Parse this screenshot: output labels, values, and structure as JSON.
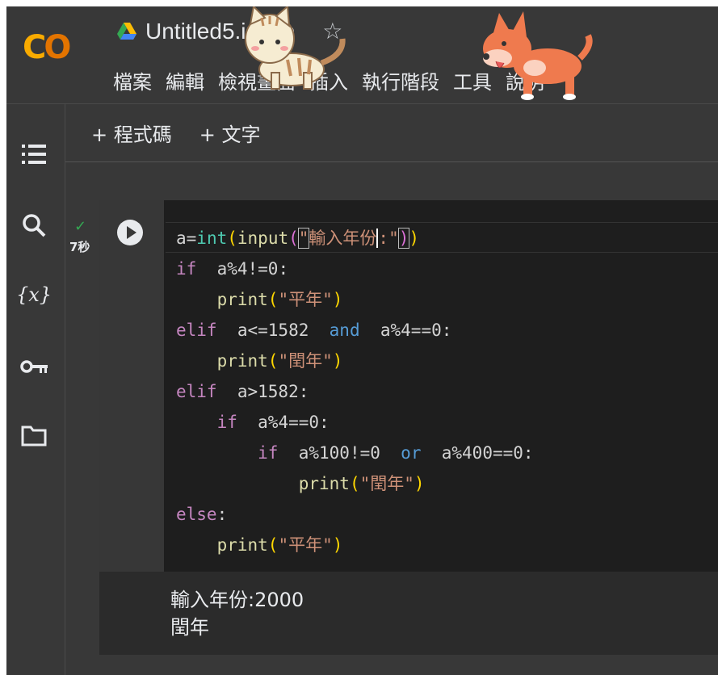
{
  "header": {
    "logo_text": "CO",
    "notebook_title": "Untitled5.ipynb",
    "star_glyph": "☆",
    "menu": [
      "檔案",
      "編輯",
      "檢視畫面",
      "插入",
      "執行階段",
      "工具",
      "說明"
    ]
  },
  "toolbar": {
    "add_code_label": "+ 程式碼",
    "add_text_label": "+ 文字"
  },
  "sidebar": {
    "icons": [
      "table-of-contents-icon",
      "search-icon",
      "variables-icon",
      "secrets-key-icon",
      "files-folder-icon"
    ],
    "variables_glyph": "{x}"
  },
  "cell": {
    "status": "completed",
    "exec_time": "7秒",
    "output_lines": [
      "輸入年份:2000",
      "閏年"
    ]
  },
  "colors": {
    "background": "#383838",
    "editor_bg": "#1e1e1e",
    "logo_orange": "#f9ab00",
    "success_green": "#34a853",
    "keyword": "#c586c0",
    "string": "#ce9178"
  }
}
